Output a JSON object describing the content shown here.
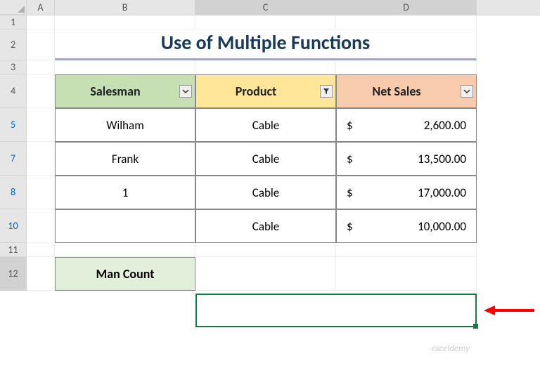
{
  "columns": [
    "A",
    "B",
    "C",
    "D"
  ],
  "rows": {
    "r1": "1",
    "r2": "2",
    "r3": "3",
    "r4": "4",
    "r5": "5",
    "r7": "7",
    "r8": "8",
    "r10": "10",
    "r11": "11",
    "r12": "12"
  },
  "title": "Use of Multiple Functions",
  "table": {
    "headers": {
      "salesman": "Salesman",
      "product": "Product",
      "netsales": "Net Sales"
    },
    "rows": [
      {
        "salesman": "Wilham",
        "product": "Cable",
        "currency": "$",
        "amount": "2,600.00"
      },
      {
        "salesman": "Frank",
        "product": "Cable",
        "currency": "$",
        "amount": "13,500.00"
      },
      {
        "salesman": "1",
        "product": "Cable",
        "currency": "$",
        "amount": "17,000.00"
      },
      {
        "salesman": "",
        "product": "Cable",
        "currency": "$",
        "amount": "10,000.00"
      }
    ]
  },
  "mancount_label": "Man Count",
  "watermark": "exceldemy",
  "chart_data": {
    "type": "table",
    "title": "Use of Multiple Functions",
    "columns": [
      "Salesman",
      "Product",
      "Net Sales"
    ],
    "rows": [
      [
        "Wilham",
        "Cable",
        2600.0
      ],
      [
        "Frank",
        "Cable",
        13500.0
      ],
      [
        "1",
        "Cable",
        17000.0
      ],
      [
        "",
        "Cable",
        10000.0
      ]
    ],
    "summary_label": "Man Count",
    "summary_value": null
  }
}
